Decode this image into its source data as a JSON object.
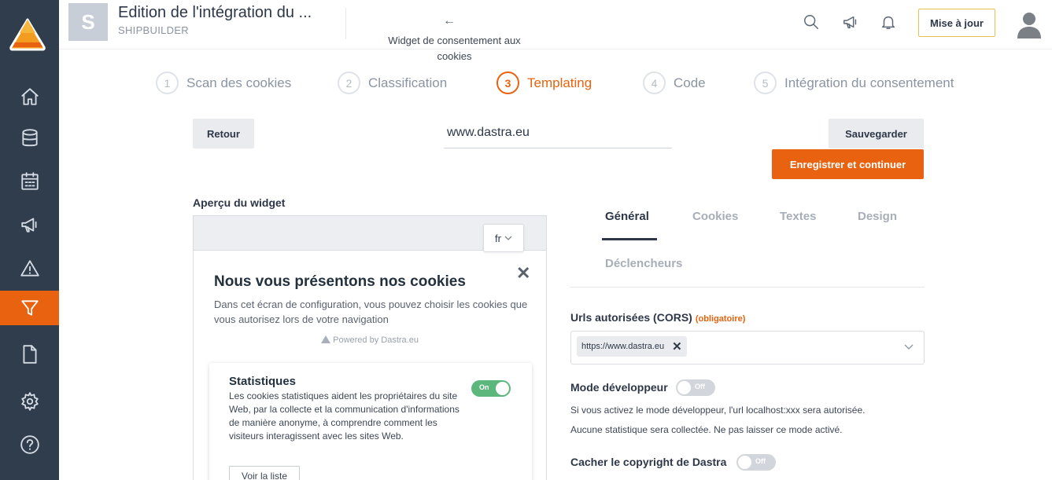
{
  "header": {
    "avatar_letter": "S",
    "title": "Edition de l'intégration du ...",
    "subtitle": "SHIPBUILDER",
    "back_arrow": "←",
    "center_title": "Widget de consentement aux cookies",
    "update_button": "Mise à jour",
    "icons": [
      "search-icon",
      "megaphone-icon",
      "bell-icon",
      "user-icon"
    ]
  },
  "sidebar": {
    "items": [
      {
        "icon": "home-icon",
        "active": false
      },
      {
        "icon": "database-icon",
        "active": false
      },
      {
        "icon": "calendar-icon",
        "active": false
      },
      {
        "icon": "megaphone-icon",
        "active": false
      },
      {
        "icon": "warning-icon",
        "active": false
      },
      {
        "icon": "funnel-icon",
        "active": true
      },
      {
        "icon": "document-icon",
        "active": false
      },
      {
        "icon": "gear-icon",
        "active": false
      },
      {
        "icon": "help-icon",
        "active": false
      }
    ]
  },
  "stepper": {
    "steps": [
      {
        "num": "1",
        "label": "Scan des cookies"
      },
      {
        "num": "2",
        "label": "Classification"
      },
      {
        "num": "3",
        "label": "Templating"
      },
      {
        "num": "4",
        "label": "Code"
      },
      {
        "num": "5",
        "label": "Intégration du consentement"
      }
    ],
    "active_index": 2
  },
  "toolbar": {
    "back_button": "Retour",
    "url_value": "www.dastra.eu",
    "save_button": "Sauvegarder",
    "save_continue_button": "Enregistrer et continuer"
  },
  "preview": {
    "label": "Aperçu du widget",
    "lang": "fr",
    "close": "✕",
    "title": "Nous vous présentons nos cookies",
    "description": "Dans cet écran de configuration, vous pouvez choisir les cookies que vous autorisez lors de votre navigation",
    "powered": "Powered by Dastra.eu",
    "card": {
      "title": "Statistiques",
      "text": "Les cookies statistiques aident les propriétaires du site Web, par la collecte et la communication d'informations de manière anonyme, à comprendre comment les visiteurs interagissent avec les sites Web.",
      "toggle_label": "On",
      "list_button": "Voir la liste"
    }
  },
  "settings": {
    "tabs": [
      "Général",
      "Cookies",
      "Textes",
      "Design",
      "Déclencheurs"
    ],
    "active_tab": "Général",
    "cors_label": "Urls autorisées (CORS)",
    "cors_required": "(obligatoire)",
    "cors_chip": "https://www.dastra.eu",
    "dev_mode_label": "Mode développeur",
    "dev_mode_toggle": "Off",
    "dev_help_1": "Si vous activez le mode développeur, l'url localhost:xxx sera autorisée.",
    "dev_help_2": "Aucune statistique sera collectée. Ne pas laisser ce mode activé.",
    "copyright_label": "Cacher le copyright de Dastra",
    "copyright_toggle": "Off"
  },
  "colors": {
    "accent": "#e8620f",
    "sidebar": "#2f3d4d",
    "toggle_on": "#5cb77d"
  }
}
